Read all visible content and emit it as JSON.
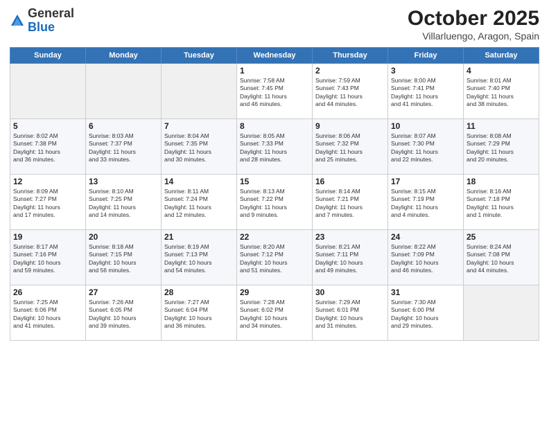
{
  "header": {
    "logo_line1": "General",
    "logo_line2": "Blue",
    "month": "October 2025",
    "location": "Villarluengo, Aragon, Spain"
  },
  "weekdays": [
    "Sunday",
    "Monday",
    "Tuesday",
    "Wednesday",
    "Thursday",
    "Friday",
    "Saturday"
  ],
  "weeks": [
    [
      {
        "day": "",
        "info": ""
      },
      {
        "day": "",
        "info": ""
      },
      {
        "day": "",
        "info": ""
      },
      {
        "day": "1",
        "info": "Sunrise: 7:58 AM\nSunset: 7:45 PM\nDaylight: 11 hours\nand 46 minutes."
      },
      {
        "day": "2",
        "info": "Sunrise: 7:59 AM\nSunset: 7:43 PM\nDaylight: 11 hours\nand 44 minutes."
      },
      {
        "day": "3",
        "info": "Sunrise: 8:00 AM\nSunset: 7:41 PM\nDaylight: 11 hours\nand 41 minutes."
      },
      {
        "day": "4",
        "info": "Sunrise: 8:01 AM\nSunset: 7:40 PM\nDaylight: 11 hours\nand 38 minutes."
      }
    ],
    [
      {
        "day": "5",
        "info": "Sunrise: 8:02 AM\nSunset: 7:38 PM\nDaylight: 11 hours\nand 36 minutes."
      },
      {
        "day": "6",
        "info": "Sunrise: 8:03 AM\nSunset: 7:37 PM\nDaylight: 11 hours\nand 33 minutes."
      },
      {
        "day": "7",
        "info": "Sunrise: 8:04 AM\nSunset: 7:35 PM\nDaylight: 11 hours\nand 30 minutes."
      },
      {
        "day": "8",
        "info": "Sunrise: 8:05 AM\nSunset: 7:33 PM\nDaylight: 11 hours\nand 28 minutes."
      },
      {
        "day": "9",
        "info": "Sunrise: 8:06 AM\nSunset: 7:32 PM\nDaylight: 11 hours\nand 25 minutes."
      },
      {
        "day": "10",
        "info": "Sunrise: 8:07 AM\nSunset: 7:30 PM\nDaylight: 11 hours\nand 22 minutes."
      },
      {
        "day": "11",
        "info": "Sunrise: 8:08 AM\nSunset: 7:29 PM\nDaylight: 11 hours\nand 20 minutes."
      }
    ],
    [
      {
        "day": "12",
        "info": "Sunrise: 8:09 AM\nSunset: 7:27 PM\nDaylight: 11 hours\nand 17 minutes."
      },
      {
        "day": "13",
        "info": "Sunrise: 8:10 AM\nSunset: 7:25 PM\nDaylight: 11 hours\nand 14 minutes."
      },
      {
        "day": "14",
        "info": "Sunrise: 8:11 AM\nSunset: 7:24 PM\nDaylight: 11 hours\nand 12 minutes."
      },
      {
        "day": "15",
        "info": "Sunrise: 8:13 AM\nSunset: 7:22 PM\nDaylight: 11 hours\nand 9 minutes."
      },
      {
        "day": "16",
        "info": "Sunrise: 8:14 AM\nSunset: 7:21 PM\nDaylight: 11 hours\nand 7 minutes."
      },
      {
        "day": "17",
        "info": "Sunrise: 8:15 AM\nSunset: 7:19 PM\nDaylight: 11 hours\nand 4 minutes."
      },
      {
        "day": "18",
        "info": "Sunrise: 8:16 AM\nSunset: 7:18 PM\nDaylight: 11 hours\nand 1 minute."
      }
    ],
    [
      {
        "day": "19",
        "info": "Sunrise: 8:17 AM\nSunset: 7:16 PM\nDaylight: 10 hours\nand 59 minutes."
      },
      {
        "day": "20",
        "info": "Sunrise: 8:18 AM\nSunset: 7:15 PM\nDaylight: 10 hours\nand 56 minutes."
      },
      {
        "day": "21",
        "info": "Sunrise: 8:19 AM\nSunset: 7:13 PM\nDaylight: 10 hours\nand 54 minutes."
      },
      {
        "day": "22",
        "info": "Sunrise: 8:20 AM\nSunset: 7:12 PM\nDaylight: 10 hours\nand 51 minutes."
      },
      {
        "day": "23",
        "info": "Sunrise: 8:21 AM\nSunset: 7:11 PM\nDaylight: 10 hours\nand 49 minutes."
      },
      {
        "day": "24",
        "info": "Sunrise: 8:22 AM\nSunset: 7:09 PM\nDaylight: 10 hours\nand 46 minutes."
      },
      {
        "day": "25",
        "info": "Sunrise: 8:24 AM\nSunset: 7:08 PM\nDaylight: 10 hours\nand 44 minutes."
      }
    ],
    [
      {
        "day": "26",
        "info": "Sunrise: 7:25 AM\nSunset: 6:06 PM\nDaylight: 10 hours\nand 41 minutes."
      },
      {
        "day": "27",
        "info": "Sunrise: 7:26 AM\nSunset: 6:05 PM\nDaylight: 10 hours\nand 39 minutes."
      },
      {
        "day": "28",
        "info": "Sunrise: 7:27 AM\nSunset: 6:04 PM\nDaylight: 10 hours\nand 36 minutes."
      },
      {
        "day": "29",
        "info": "Sunrise: 7:28 AM\nSunset: 6:02 PM\nDaylight: 10 hours\nand 34 minutes."
      },
      {
        "day": "30",
        "info": "Sunrise: 7:29 AM\nSunset: 6:01 PM\nDaylight: 10 hours\nand 31 minutes."
      },
      {
        "day": "31",
        "info": "Sunrise: 7:30 AM\nSunset: 6:00 PM\nDaylight: 10 hours\nand 29 minutes."
      },
      {
        "day": "",
        "info": ""
      }
    ]
  ]
}
